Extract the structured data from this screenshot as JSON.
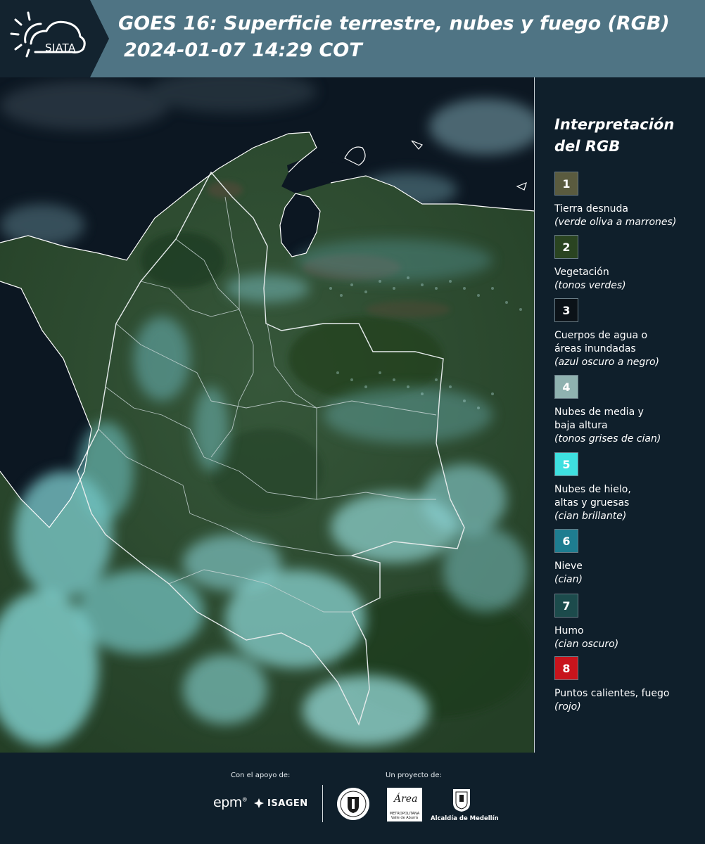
{
  "header": {
    "logo_text": "SIATA",
    "title_line1": "GOES 16: Superficie terrestre, nubes y fuego (RGB)",
    "title_line2": "2024-01-07 14:29 COT"
  },
  "legend": {
    "title_line1": "Interpretación",
    "title_line2": "del RGB",
    "items": [
      {
        "number": "1",
        "color": "#5a5b3f",
        "label": "Tierra desnuda",
        "desc": "(verde oliva a marrones)"
      },
      {
        "number": "2",
        "color": "#2a4421",
        "label": "Vegetación",
        "desc": "(tonos verdes)"
      },
      {
        "number": "3",
        "color": "#0b1218",
        "label": "Cuerpos de agua o áreas inundadas",
        "desc": "(azul oscuro a negro)"
      },
      {
        "number": "4",
        "color": "#8fb2b0",
        "label": "Nubes de media y baja altura",
        "desc": "(tonos grises de cian)"
      },
      {
        "number": "5",
        "color": "#3ee0e0",
        "label": "Nubes de hielo, altas y gruesas",
        "desc": "(cian brillante)"
      },
      {
        "number": "6",
        "color": "#1e7d90",
        "label": "Nieve",
        "desc": "(cian)"
      },
      {
        "number": "7",
        "color": "#1c4b4c",
        "label": "Humo",
        "desc": "(cian oscuro)"
      },
      {
        "number": "8",
        "color": "#c8141c",
        "label": "Puntos calientes, fuego",
        "desc": "(rojo)"
      }
    ]
  },
  "footer": {
    "support_label": "Con el apoyo de:",
    "project_label": "Un proyecto de:",
    "epm_logo": "epm",
    "isagen_logo": "ISAGEN",
    "area_logo_word": "Área",
    "area_logo_small": "METROPOLITANA Valle de Aburrá",
    "alcaldia_text": "Alcaldía de Medellín"
  },
  "colors": {
    "header_bg": "#4f7484",
    "header_dark": "#13232f",
    "page_bg": "#0f1f2b",
    "vegetation": "#2d4a2a",
    "ocean": "#0b1622",
    "cloud_cyan": "#8fe0e0"
  }
}
